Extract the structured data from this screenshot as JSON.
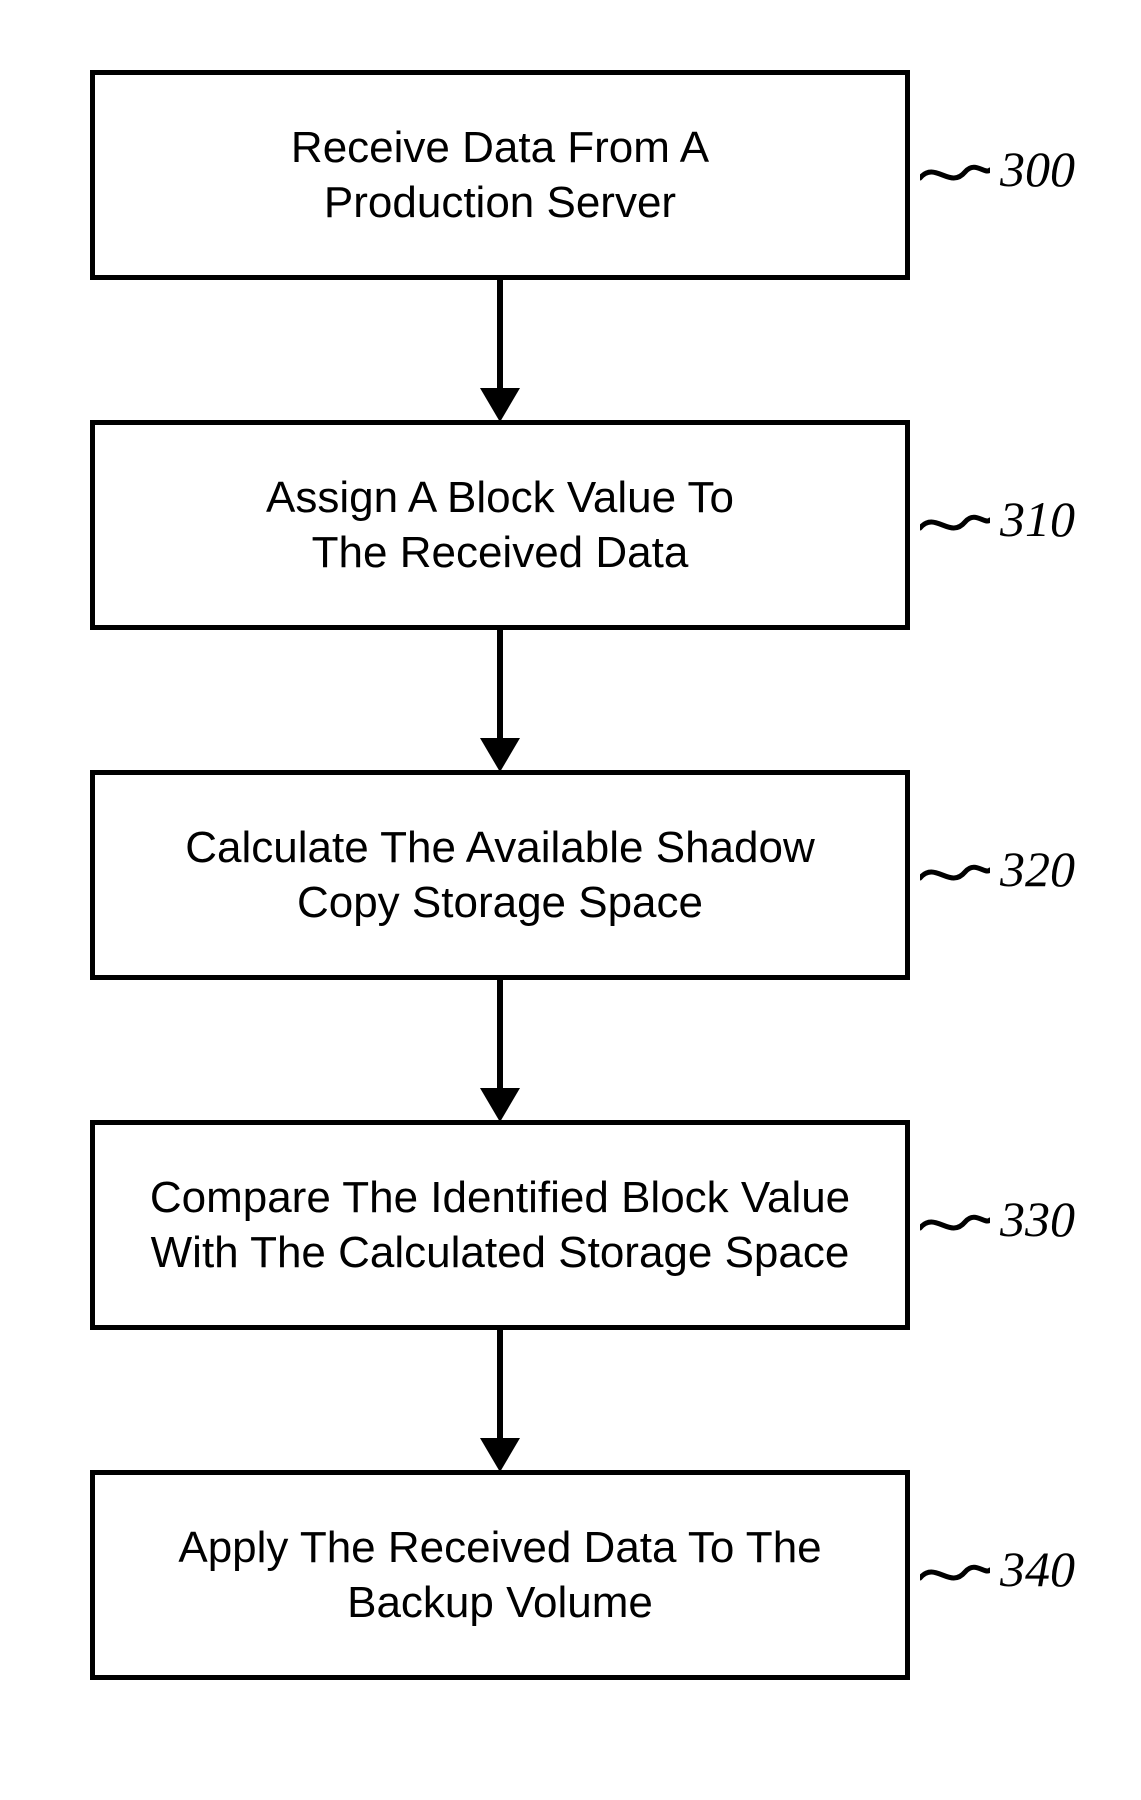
{
  "chart_data": {
    "type": "flowchart",
    "direction": "top-to-bottom",
    "nodes": [
      {
        "id": "300",
        "text": "Receive Data From A\nProduction Server"
      },
      {
        "id": "310",
        "text": "Assign A Block Value To\nThe Received Data"
      },
      {
        "id": "320",
        "text": "Calculate The Available Shadow\nCopy Storage Space"
      },
      {
        "id": "330",
        "text": "Compare The Identified Block Value\nWith The Calculated Storage Space"
      },
      {
        "id": "340",
        "text": "Apply The Received Data To The\nBackup Volume"
      }
    ],
    "edges": [
      {
        "from": "300",
        "to": "310"
      },
      {
        "from": "310",
        "to": "320"
      },
      {
        "from": "320",
        "to": "330"
      },
      {
        "from": "330",
        "to": "340"
      }
    ]
  },
  "steps": [
    {
      "label_line1": "Receive Data From A",
      "label_line2": "Production Server",
      "ref": "300"
    },
    {
      "label_line1": "Assign A Block Value To",
      "label_line2": "The Received Data",
      "ref": "310"
    },
    {
      "label_line1": "Calculate The Available Shadow",
      "label_line2": "Copy Storage Space",
      "ref": "320"
    },
    {
      "label_line1": "Compare The Identified Block Value",
      "label_line2": "With The Calculated Storage Space",
      "ref": "330"
    },
    {
      "label_line1": "Apply The Received Data To The",
      "label_line2": "Backup Volume",
      "ref": "340"
    }
  ]
}
